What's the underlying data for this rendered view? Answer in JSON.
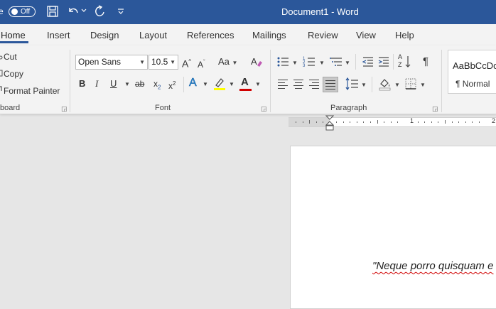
{
  "titlebar": {
    "autosave_label_fragment": "e",
    "autosave_state": "Off",
    "document_title": "Document1  -  Word",
    "icons": [
      "save-icon",
      "undo-icon",
      "redo-icon",
      "customize-qat-icon"
    ],
    "background_color": "#2b579a"
  },
  "tabs": [
    {
      "label": "Home",
      "active": true
    },
    {
      "label": "Insert"
    },
    {
      "label": "Design"
    },
    {
      "label": "Layout"
    },
    {
      "label": "References"
    },
    {
      "label": "Mailings"
    },
    {
      "label": "Review"
    },
    {
      "label": "View"
    },
    {
      "label": "Help"
    }
  ],
  "clipboard": {
    "cut": "Cut",
    "copy": "Copy",
    "format_painter": "Format Painter",
    "group_label": "board"
  },
  "font": {
    "font_name": "Open Sans",
    "font_size": "10.5",
    "grow": "A",
    "shrink": "A",
    "change_case": "Aa",
    "bold": "B",
    "italic": "I",
    "underline": "U",
    "strike": "ab",
    "subscript": "x",
    "subscript_mark": "2",
    "superscript": "x",
    "superscript_mark": "2",
    "text_effects": "A",
    "font_color_letter": "A",
    "font_color": "#d00000",
    "highlight_color": "#ffff00",
    "group_label": "Font"
  },
  "paragraph": {
    "sort": "A",
    "sort_z": "Z",
    "pilcrow": "¶",
    "group_label": "Paragraph"
  },
  "styles": {
    "preview": "AaBbCcDc",
    "name": "¶ Normal"
  },
  "ruler": {
    "numbers": [
      "1",
      "2"
    ]
  },
  "document": {
    "text": "\"Neque porro quisquam e"
  }
}
